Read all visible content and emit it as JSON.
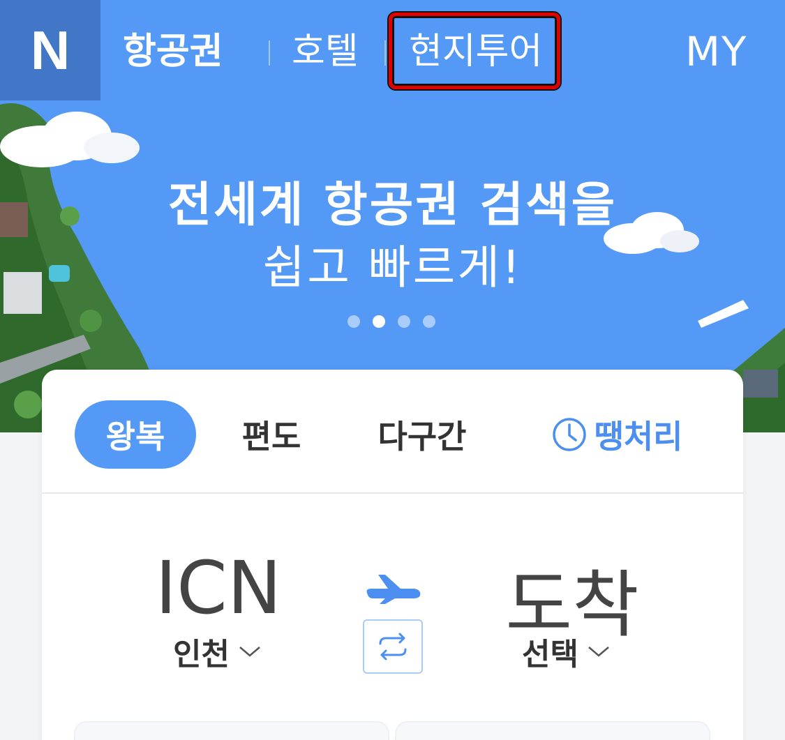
{
  "app": {
    "logo_letter": "N"
  },
  "nav": {
    "primary": "항공권",
    "hotel": "호텔",
    "tour": "현지투어",
    "my": "MY"
  },
  "banner": {
    "title": "전세계 항공권 검색을",
    "subtitle": "쉽고 빠르게!",
    "page_count": 4,
    "active_page": 2
  },
  "tabs": {
    "round_trip": "왕복",
    "one_way": "편도",
    "multi_city": "다구간",
    "last_minute": "땡처리"
  },
  "route": {
    "origin_code": "ICN",
    "origin_name": "인천",
    "destination_code": "도착",
    "destination_name": "선택"
  },
  "colors": {
    "brand_blue": "#5499f5",
    "logo_bg": "#4277c8",
    "highlight": "#e10000"
  }
}
